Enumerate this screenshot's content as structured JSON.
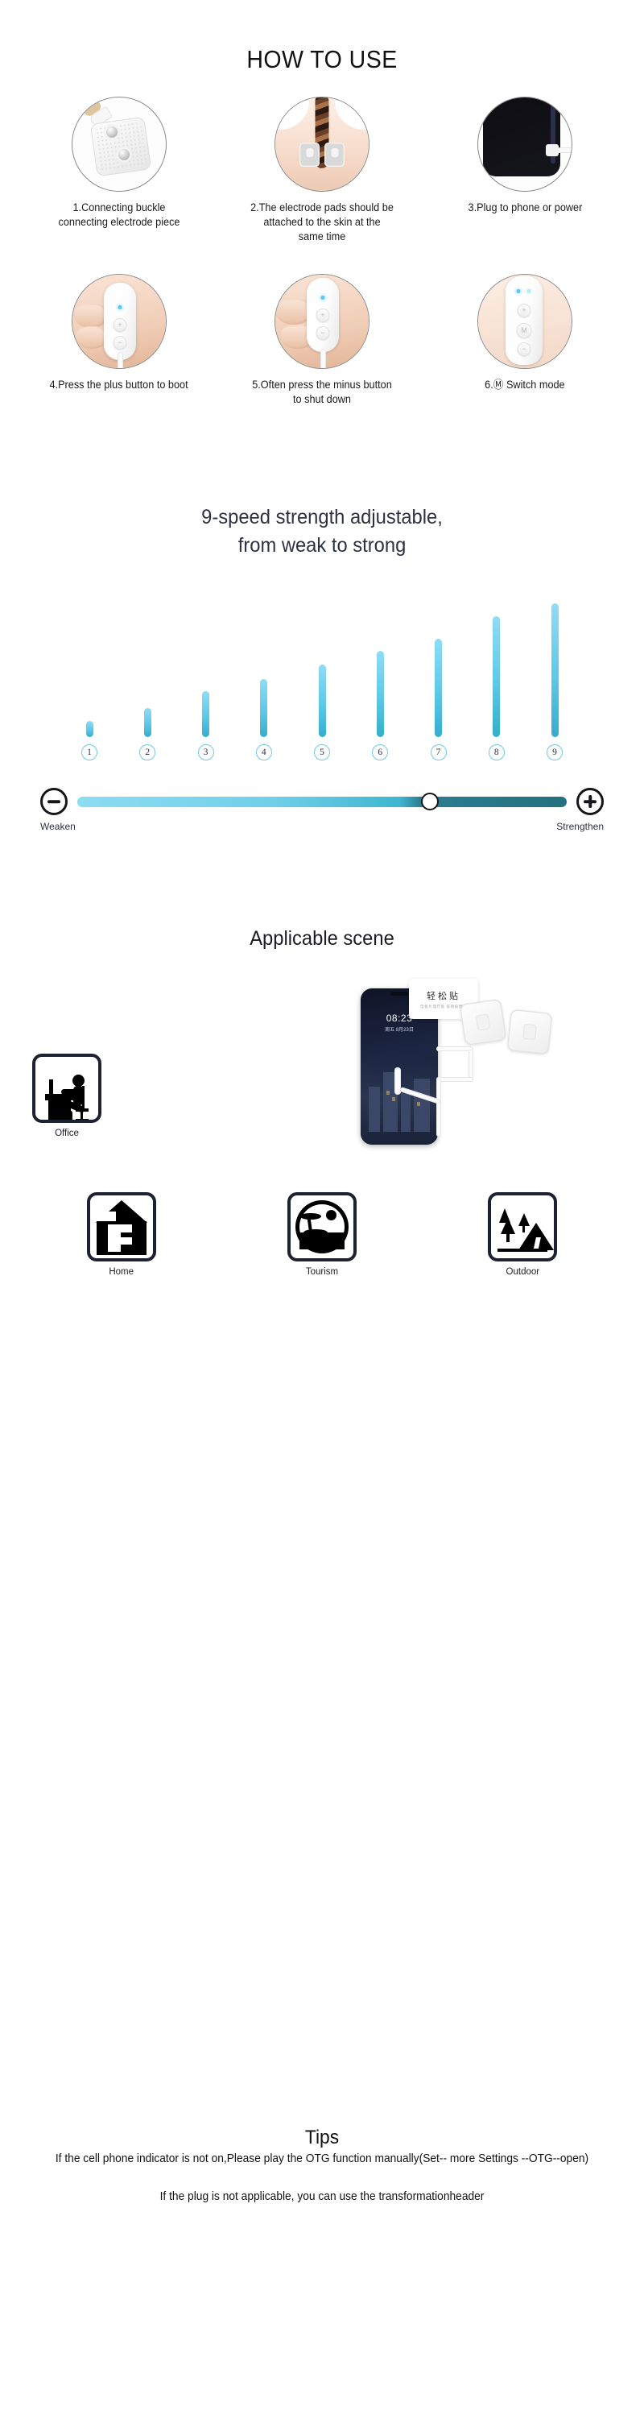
{
  "how_to_use": {
    "title": "HOW TO USE",
    "steps": [
      {
        "caption": "1.Connecting buckle connecting electrode piece",
        "icon": "electrode-pad-photo"
      },
      {
        "caption": "2.The electrode pads should be attached to the skin at the same time",
        "icon": "back-with-pads-photo"
      },
      {
        "caption": "3.Plug to phone or power",
        "icon": "phone-plug-photo"
      },
      {
        "caption": "4.Press the plus button to boot",
        "icon": "device-plus-button-photo"
      },
      {
        "caption": "5.Often press the minus button to shut down",
        "icon": "device-minus-button-photo"
      },
      {
        "caption": "6.Ⓜ Switch mode",
        "icon": "device-mode-button-photo"
      }
    ]
  },
  "speed": {
    "title_line1": "9-speed strength adjustable,",
    "title_line2": "from weak to strong",
    "weaken_label": "Weaken",
    "strengthen_label": "Strengthen",
    "minus_icon": "minus-circle-icon",
    "plus_icon": "plus-circle-icon",
    "knob_position_percent": 72
  },
  "chart_data": {
    "type": "bar",
    "title": "9-speed strength adjustable, from weak to strong",
    "categories": [
      "1",
      "2",
      "3",
      "4",
      "5",
      "6",
      "7",
      "8",
      "9"
    ],
    "values": [
      18,
      33,
      52,
      66,
      82,
      98,
      112,
      137,
      152
    ],
    "xlabel": "",
    "ylabel": "",
    "ylim": [
      0,
      160
    ],
    "grid": false,
    "legend": "none",
    "bar_color_top": "#8fdcf5",
    "bar_color_bottom": "#35aecb",
    "annotations": [
      "Weaken",
      "Strengthen"
    ]
  },
  "scene": {
    "title": "Applicable scene",
    "phone": {
      "time": "08:23",
      "date": "周五 8月23日"
    },
    "pad_card": {
      "chinese": "轻松贴",
      "sub": "电极片理疗贴 低频按摩贴"
    },
    "tiles": [
      {
        "label": "Office",
        "icon": "office-desk-icon"
      },
      {
        "label": "Home",
        "icon": "home-house-icon"
      },
      {
        "label": "Tourism",
        "icon": "tourism-island-icon"
      },
      {
        "label": "Outdoor",
        "icon": "outdoor-tent-icon"
      }
    ]
  },
  "tips": {
    "title": "Tips",
    "paragraph1": "If the cell phone indicator is not on,Please play the OTG function manually(Set-- more Settings --OTG--open)",
    "paragraph2": "If the plug is not applicable, you can use the transformationheader"
  },
  "colors": {
    "accent_light": "#8ddcf2",
    "accent_dark": "#23707f",
    "heading_navy": "#2d3142",
    "tile_border": "#1d2233"
  }
}
